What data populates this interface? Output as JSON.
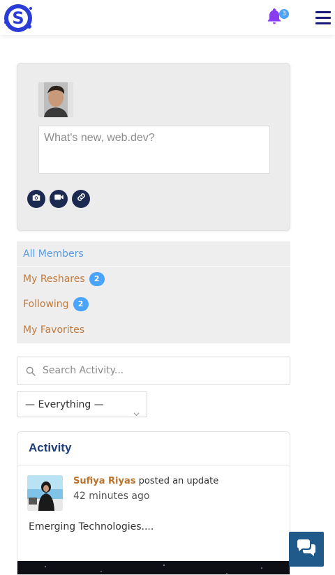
{
  "header": {
    "logo_icon": "site-logo-icon",
    "notifications_count": "3",
    "bell_color": "#8a3df0",
    "menu_icon": "hamburger-icon"
  },
  "post_form": {
    "placeholder": "What's new, web.dev?",
    "buttons": [
      "camera-icon",
      "video-icon",
      "link-icon"
    ]
  },
  "activity_nav": {
    "items": [
      {
        "label": "All Members",
        "active": true
      },
      {
        "label": "My Reshares",
        "count": "2"
      },
      {
        "label": "Following",
        "count": "2"
      },
      {
        "label": "My Favorites"
      }
    ]
  },
  "search": {
    "placeholder": "Search Activity..."
  },
  "filter": {
    "selected": "— Everything —"
  },
  "activity": {
    "title": "Activity",
    "post": {
      "author": "Sufiya Riyas",
      "action": "posted an update",
      "time": "42 minutes ago",
      "content": "Emerging Technologies...."
    }
  },
  "colors": {
    "accent_blue": "#4aa3ff",
    "link_orange": "#c07a3e",
    "navy": "#1d3d78",
    "chat_bg": "#1f5a8a"
  }
}
